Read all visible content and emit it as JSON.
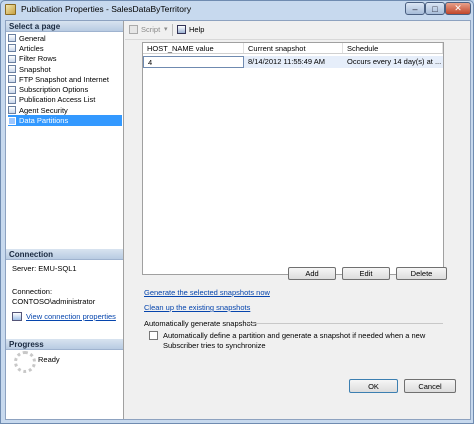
{
  "window": {
    "title": "Publication Properties - SalesDataByTerritory",
    "min_glyph": "–",
    "max_glyph": "□",
    "close_glyph": "✕"
  },
  "left": {
    "select_page_header": "Select a page",
    "pages": [
      {
        "label": "General",
        "selected": false
      },
      {
        "label": "Articles",
        "selected": false
      },
      {
        "label": "Filter Rows",
        "selected": false
      },
      {
        "label": "Snapshot",
        "selected": false
      },
      {
        "label": "FTP Snapshot and Internet",
        "selected": false
      },
      {
        "label": "Subscription Options",
        "selected": false
      },
      {
        "label": "Publication Access List",
        "selected": false
      },
      {
        "label": "Agent Security",
        "selected": false
      },
      {
        "label": "Data Partitions",
        "selected": true
      }
    ],
    "connection_header": "Connection",
    "server": "Server: EMU-SQL1",
    "connection_label": "Connection:",
    "connection_user": "CONTOSO\\administrator",
    "view_connection": "View connection properties",
    "progress_header": "Progress",
    "progress_status": "Ready"
  },
  "toolbar": {
    "script_label": "Script",
    "script_caret": "▾",
    "help_label": "Help"
  },
  "grid": {
    "columns": [
      "HOST_NAME value",
      "Current snapshot",
      "Schedule"
    ],
    "rows": [
      [
        "4",
        "8/14/2012 11:55:49 AM",
        "Occurs every 14 day(s) at ..."
      ]
    ]
  },
  "buttons": {
    "add": "Add",
    "edit": "Edit",
    "delete": "Delete",
    "ok": "OK",
    "cancel": "Cancel"
  },
  "links": {
    "generate": "Generate the selected snapshots now",
    "clean": "Clean up the existing snapshots"
  },
  "auto": {
    "group_label": "Automatically generate snapshots",
    "checkbox_line1": "Automatically define a partition and generate a snapshot if needed when a new",
    "checkbox_line2": "Subscriber tries to synchronize",
    "checked": false
  }
}
